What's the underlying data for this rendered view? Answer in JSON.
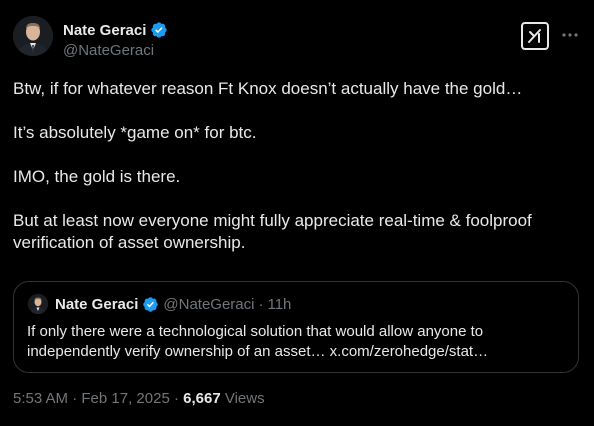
{
  "author": {
    "name": "Nate Geraci",
    "handle": "@NateGeraci",
    "verified_color": "#1d9bf0"
  },
  "icons": {
    "verified": "verified-badge-icon",
    "grok": "grok-icon",
    "more": "more-options-icon"
  },
  "tweet": {
    "paragraphs": [
      "Btw, if for whatever reason Ft Knox doesn’t actually have the gold…",
      "It’s absolutely *game on* for btc.",
      "IMO, the gold is there.",
      "But at least now everyone might fully appreciate real-time & foolproof verification of asset ownership."
    ]
  },
  "quote": {
    "name": "Nate Geraci",
    "handle": "@NateGeraci",
    "separator": "·",
    "time": "11h",
    "text": "If only there were a technological solution that would allow anyone to independently verify ownership of an asset… x.com/zerohedge/stat…"
  },
  "meta": {
    "time": "5:53 AM",
    "separator": "·",
    "date": "Feb 17, 2025",
    "separator2": "·",
    "views_count": "6,667",
    "views_label": "Views"
  },
  "colors": {
    "background": "#000000",
    "text": "#e7e9ea",
    "muted": "#71767b",
    "border": "#2f3336",
    "accent": "#1d9bf0"
  }
}
